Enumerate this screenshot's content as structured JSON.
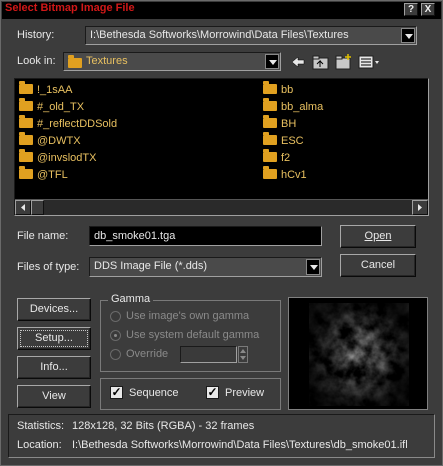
{
  "window": {
    "title": "Select Bitmap Image File",
    "help_button": "?",
    "close_button": "X"
  },
  "history": {
    "label": "History:",
    "value": "I:\\Bethesda Softworks\\Morrowind\\Data Files\\Textures"
  },
  "lookin": {
    "label": "Look in:",
    "value": "Textures"
  },
  "toolbar": {
    "icons": [
      "back-icon",
      "up-folder-icon",
      "new-folder-icon",
      "view-menu-icon"
    ]
  },
  "files": {
    "col1": [
      "!_1sAA",
      "#_old_TX",
      "#_reflectDDSold",
      "@DWTX",
      "@invslodTX",
      "@TFL"
    ],
    "col2": [
      "bb",
      "bb_alma",
      "BH",
      "ESC",
      "f2",
      "hCv1"
    ]
  },
  "filename": {
    "label": "File name:",
    "value": "db_smoke01.tga"
  },
  "filetype": {
    "label": "Files of type:",
    "value": "DDS Image File (*.dds)"
  },
  "buttons": {
    "open": "Open",
    "cancel": "Cancel",
    "devices": "Devices...",
    "setup": "Setup...",
    "info": "Info...",
    "view": "View"
  },
  "gamma": {
    "title": "Gamma",
    "own": "Use image's own gamma",
    "system": "Use system default gamma",
    "override": "Override",
    "override_value": ""
  },
  "options": {
    "sequence": "Sequence",
    "preview": "Preview"
  },
  "status": {
    "stats_label": "Statistics:",
    "stats_value": "128x128, 32 Bits (RGBA) - 32 frames",
    "location_label": "Location:",
    "location_value": "I:\\Bethesda Softworks\\Morrowind\\Data Files\\Textures\\db_smoke01.ifl"
  },
  "colors": {
    "title": "#d01818",
    "folder": "#e0a020",
    "folder_text": "#e8c060",
    "background": "#3c3c3c"
  }
}
